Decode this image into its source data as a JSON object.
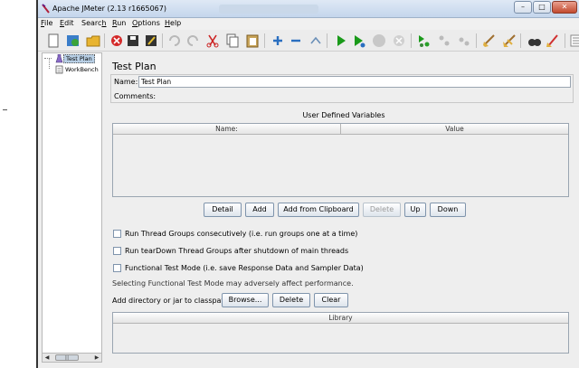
{
  "window": {
    "title": "Apache JMeter (2.13 r1665067)",
    "controls": {
      "minimize": "–",
      "maximize": "□",
      "close": "✕"
    }
  },
  "menu": [
    {
      "pre": "",
      "u": "F",
      "post": "ile"
    },
    {
      "pre": "",
      "u": "E",
      "post": "dit"
    },
    {
      "pre": "Searc",
      "u": "h",
      "post": ""
    },
    {
      "pre": "",
      "u": "R",
      "post": "un"
    },
    {
      "pre": "",
      "u": "O",
      "post": "ptions"
    },
    {
      "pre": "",
      "u": "H",
      "post": "elp"
    }
  ],
  "toolbar": {
    "icons": [
      "new-icon",
      "templates-icon",
      "open-icon",
      "close-icon",
      "save-icon",
      "save-as-icon",
      "undo-icon",
      "redo-icon",
      "cut-icon",
      "copy-icon",
      "paste-icon",
      "expand-icon",
      "collapse-icon",
      "toggle-icon",
      "start-icon",
      "start-no-pauses-icon",
      "stop-icon",
      "shutdown-icon",
      "remote-start-icon",
      "remote-stop-icon",
      "remote-shutdown-icon",
      "clear-icon",
      "clear-all-icon",
      "search-icon",
      "reset-search-icon",
      "function-helper-icon"
    ]
  },
  "tree": {
    "items": [
      {
        "label": "Test Plan",
        "selected": true
      },
      {
        "label": "WorkBench",
        "selected": false
      }
    ],
    "scroll": {
      "left": "◀",
      "right": "▶",
      "grip": "|||"
    }
  },
  "test_plan": {
    "heading": "Test Plan",
    "name_label": "Name:",
    "name_value": "Test Plan",
    "comments_label": "Comments:",
    "comments_value": "",
    "variables_title": "User Defined Variables",
    "columns": [
      "Name:",
      "Value"
    ],
    "buttons": [
      {
        "label": "Detail",
        "enabled": true
      },
      {
        "label": "Add",
        "enabled": true
      },
      {
        "label": "Add from Clipboard",
        "enabled": true
      },
      {
        "label": "Delete",
        "enabled": false
      },
      {
        "label": "Up",
        "enabled": true
      },
      {
        "label": "Down",
        "enabled": true
      }
    ],
    "options": [
      {
        "label": "Run Thread Groups consecutively (i.e. run groups one at a time)",
        "checked": false
      },
      {
        "label": "Run tearDown Thread Groups after shutdown of main threads",
        "checked": false
      },
      {
        "label": "Functional Test Mode (i.e. save Response Data and Sampler Data)",
        "checked": false
      }
    ],
    "functional_note": "Selecting Functional Test Mode may adversely affect performance.",
    "classpath_label": "Add directory or jar to classpath",
    "classpath_buttons": [
      "Browse...",
      "Delete",
      "Clear"
    ],
    "library_header": "Library"
  },
  "colors": {
    "selection": "#b8cfe5",
    "start": "#1a9a1a",
    "panel": "#eeeeee"
  }
}
